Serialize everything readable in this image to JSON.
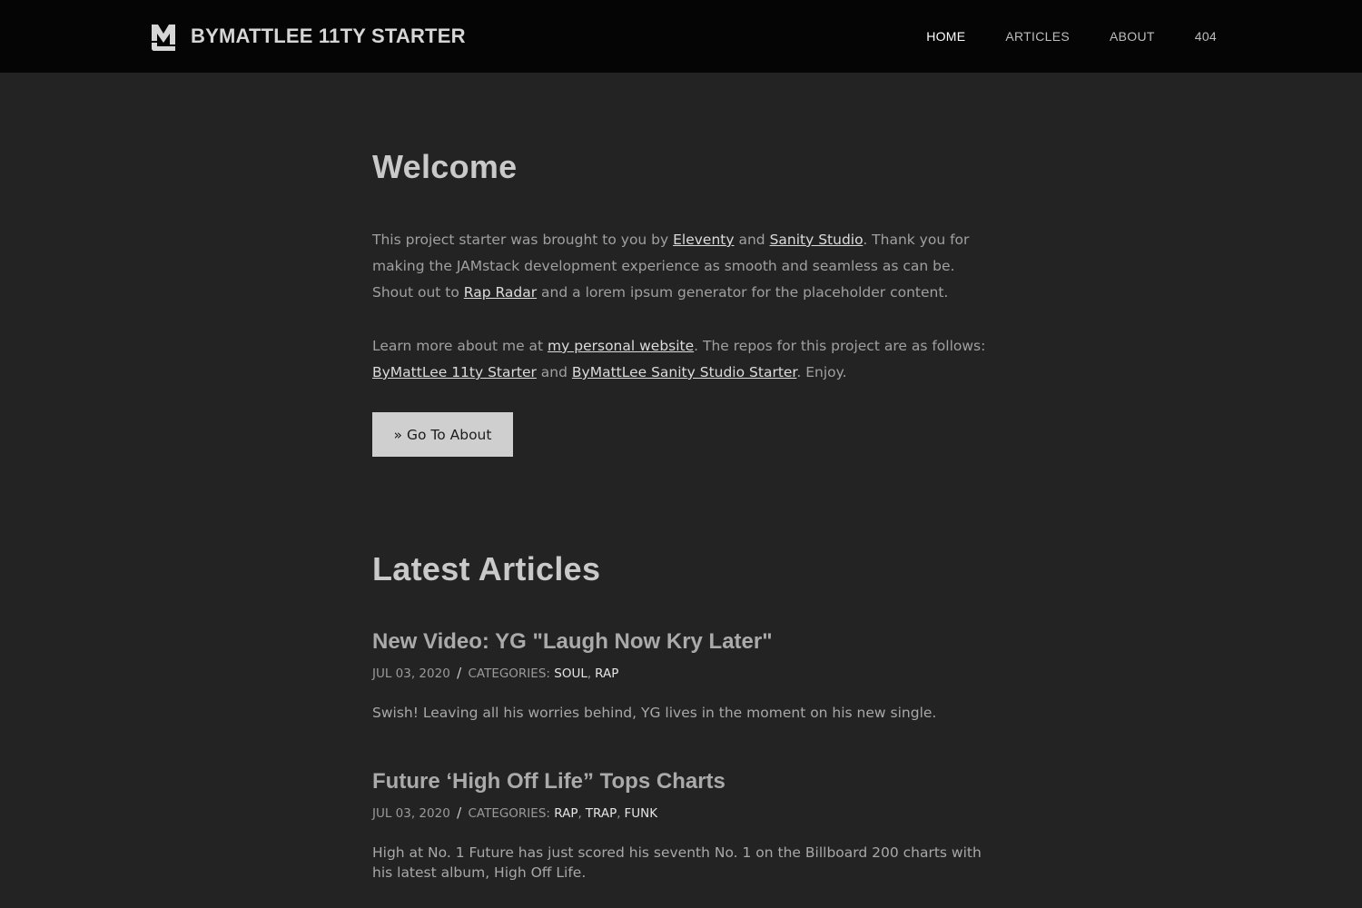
{
  "header": {
    "brand_text": "BYMATTLEE 11TY STARTER",
    "logo_icon": "m-monogram-logo",
    "nav": [
      {
        "label": "HOME",
        "active": true
      },
      {
        "label": "ARTICLES",
        "active": false
      },
      {
        "label": "ABOUT",
        "active": false
      },
      {
        "label": "404",
        "active": false
      }
    ]
  },
  "welcome": {
    "title": "Welcome",
    "p1": {
      "t1": "This project starter was brought to you by ",
      "link1": "Eleventy",
      "t2": " and ",
      "link2": "Sanity Studio",
      "t3": ". Thank you for making the JAMstack development experience as smooth and seamless as can be. Shout out to ",
      "link3": "Rap Radar",
      "t4": " and a lorem ipsum generator for the placeholder content."
    },
    "p2": {
      "t1": "Learn more about me at ",
      "link1": "my personal website",
      "t2": ". The repos for this project are as follows: ",
      "link2": "ByMattLee 11ty Starter",
      "t3": " and ",
      "link3": "ByMattLee Sanity Studio Starter",
      "t4": ". Enjoy."
    },
    "button_label": "» Go To About"
  },
  "latest": {
    "title": "Latest Articles",
    "categories_label": "CATEGORIES:",
    "date_separator": "/",
    "articles": [
      {
        "title": "New Video: YG \"Laugh Now Kry Later\"",
        "date": "JUL 03, 2020",
        "categories": [
          "SOUL",
          "RAP"
        ],
        "excerpt": "Swish! Leaving all his worries behind, YG lives in the moment on his new single."
      },
      {
        "title": "Future ‘High Off Life” Tops Charts",
        "date": "JUL 03, 2020",
        "categories": [
          "RAP",
          "TRAP",
          "FUNK"
        ],
        "excerpt": "High at No. 1 Future has just scored his seventh No. 1 on the Billboard 200 charts with his latest album, High Off Life."
      }
    ]
  },
  "colors": {
    "header_bg": "#050505",
    "page_bg": "#232323",
    "button_bg": "#cfcfcf"
  }
}
